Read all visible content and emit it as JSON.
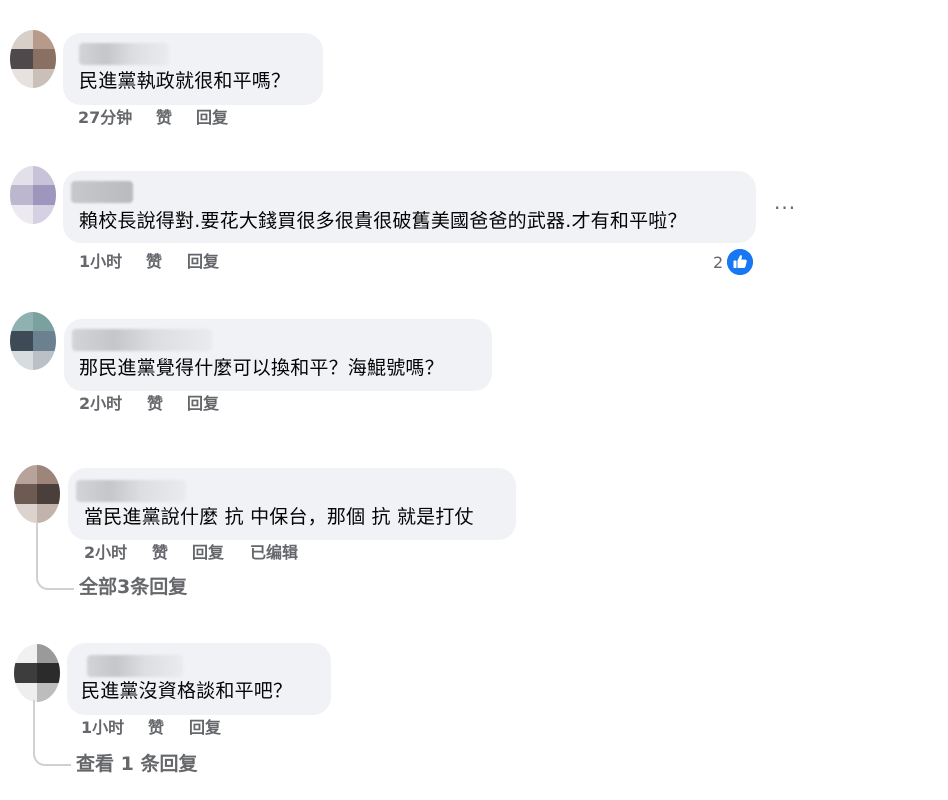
{
  "comments": [
    {
      "text": "民進黨執政就很和平嗎？",
      "time": "27分钟",
      "like": "赞",
      "reply": "回复"
    },
    {
      "text": "賴校長說得對.要花大錢買很多很貴很破舊美國爸爸的武器.才有和平啦？",
      "time": "1小时",
      "like": "赞",
      "reply": "回复",
      "reaction_count": "2",
      "more_menu": "···"
    },
    {
      "text": "那民進黨覺得什麼可以換和平？海鯤號嗎？",
      "time": "2小时",
      "like": "赞",
      "reply": "回复"
    },
    {
      "text": "當民進黨說什麼 抗 中保台，那個 抗 就是打仗",
      "time": "2小时",
      "like": "赞",
      "reply": "回复",
      "edited": "已编辑",
      "view_replies": "全部3条回复"
    },
    {
      "text": "民進黨沒資格談和平吧？",
      "time": "1小时",
      "like": "赞",
      "reply": "回复",
      "view_replies": "查看 1 条回复"
    }
  ],
  "colors": {
    "bubble": "#f0f2f5",
    "meta_text": "#65676b",
    "like_blue": "#1877f2"
  },
  "icons": {
    "like_reaction": "thumbs-up-icon",
    "more": "more-horizontal-icon"
  }
}
